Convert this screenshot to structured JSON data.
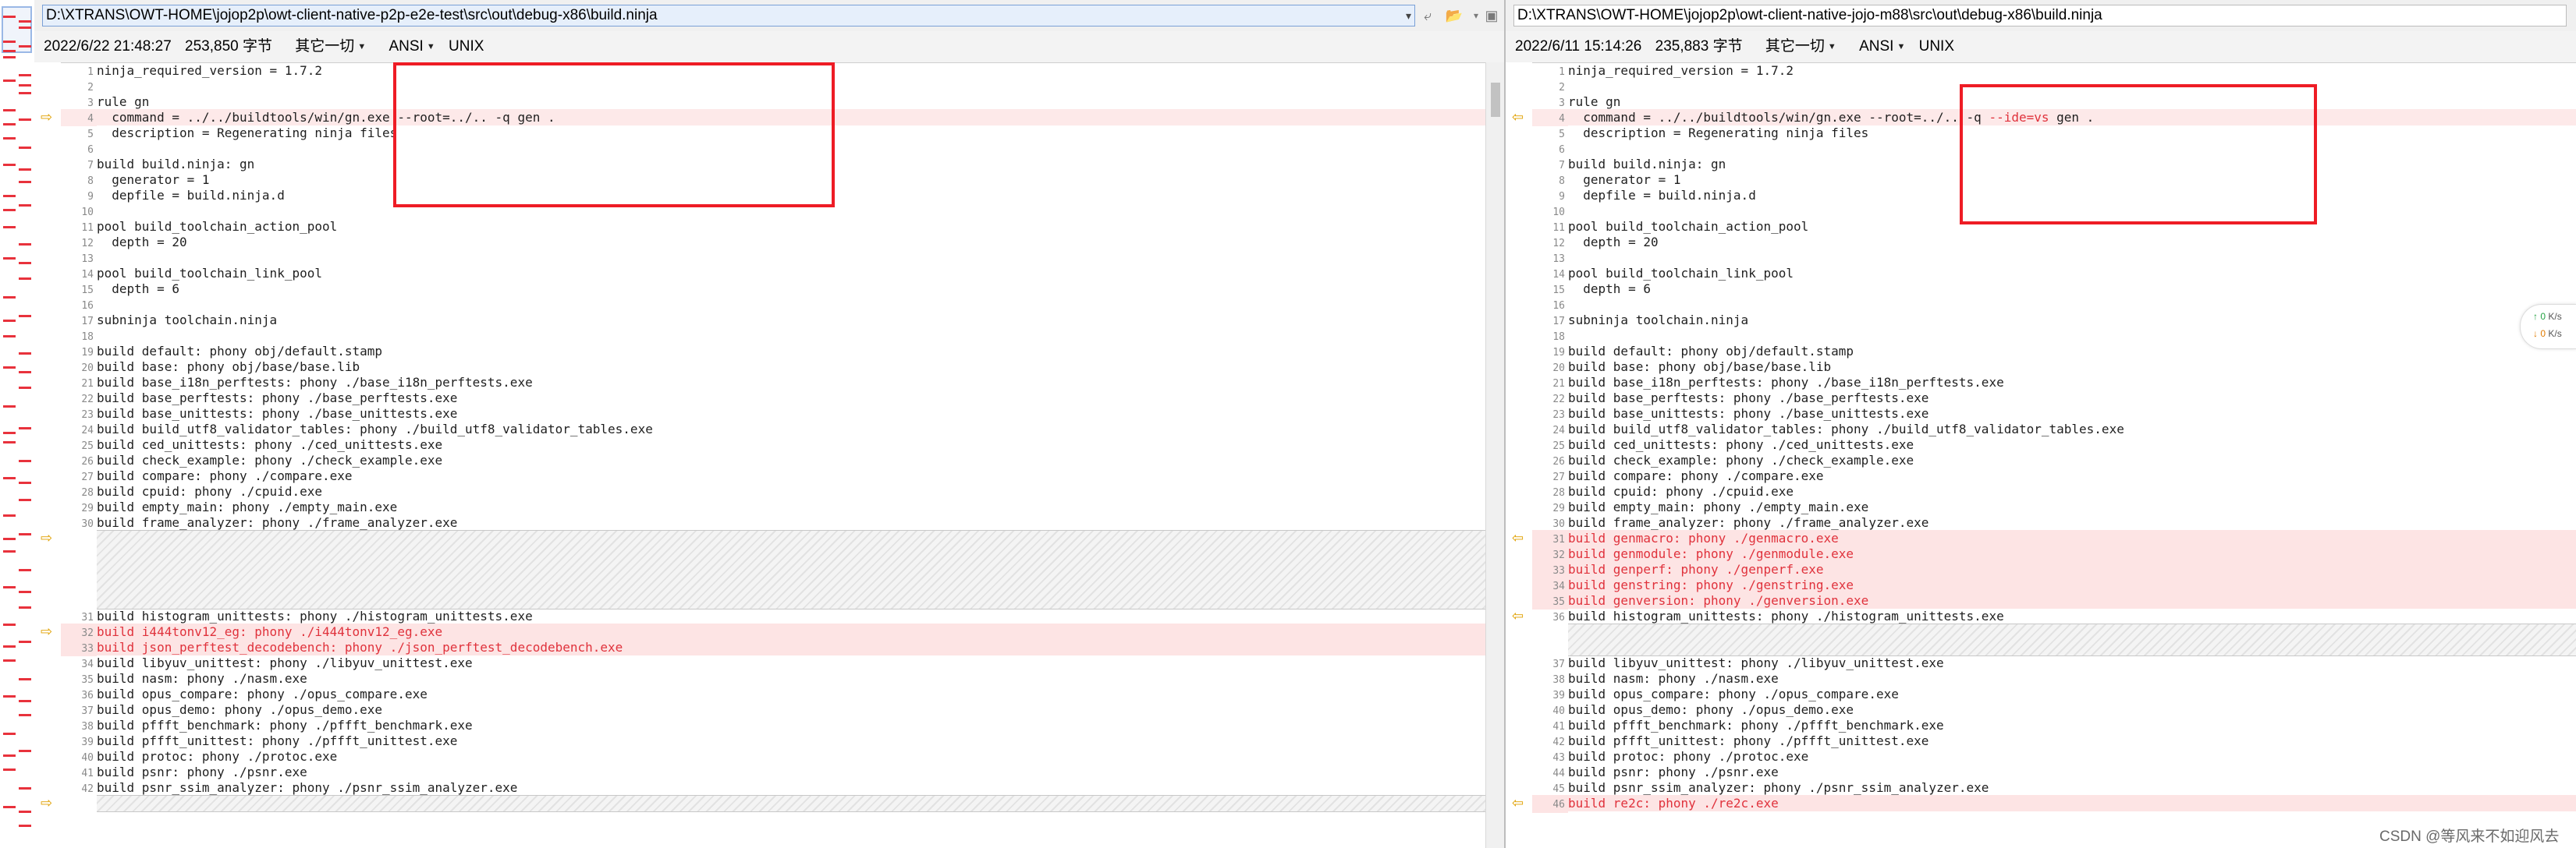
{
  "left": {
    "path": "D:\\XTRANS\\OWT-HOME\\jojop2p\\owt-client-native-p2p-e2e-test\\src\\out\\debug-x86\\build.ninja",
    "datetime": "2022/6/22 21:48:27",
    "size": "253,850 字节",
    "filter": "其它一切",
    "encoding": "ANSI",
    "eol": "UNIX",
    "lines": [
      {
        "n": "1",
        "t": "ninja_required_version = 1.7.2",
        "c": ""
      },
      {
        "n": "2",
        "t": "",
        "c": ""
      },
      {
        "n": "3",
        "t": "rule gn",
        "c": ""
      },
      {
        "n": "4",
        "t": "  command = ../../buildtools/win/gn.exe --root=../.. -q gen .",
        "c": "mod"
      },
      {
        "n": "5",
        "t": "  description = Regenerating ninja files",
        "c": ""
      },
      {
        "n": "6",
        "t": "",
        "c": ""
      },
      {
        "n": "7",
        "t": "build build.ninja: gn",
        "c": ""
      },
      {
        "n": "8",
        "t": "  generator = 1",
        "c": ""
      },
      {
        "n": "9",
        "t": "  depfile = build.ninja.d",
        "c": ""
      },
      {
        "n": "10",
        "t": "",
        "c": ""
      },
      {
        "n": "11",
        "t": "pool build_toolchain_action_pool",
        "c": ""
      },
      {
        "n": "12",
        "t": "  depth = 20",
        "c": ""
      },
      {
        "n": "13",
        "t": "",
        "c": ""
      },
      {
        "n": "14",
        "t": "pool build_toolchain_link_pool",
        "c": ""
      },
      {
        "n": "15",
        "t": "  depth = 6",
        "c": ""
      },
      {
        "n": "16",
        "t": "",
        "c": ""
      },
      {
        "n": "17",
        "t": "subninja toolchain.ninja",
        "c": ""
      },
      {
        "n": "18",
        "t": "",
        "c": ""
      },
      {
        "n": "19",
        "t": "build default: phony obj/default.stamp",
        "c": ""
      },
      {
        "n": "20",
        "t": "build base: phony obj/base/base.lib",
        "c": ""
      },
      {
        "n": "21",
        "t": "build base_i18n_perftests: phony ./base_i18n_perftests.exe",
        "c": ""
      },
      {
        "n": "22",
        "t": "build base_perftests: phony ./base_perftests.exe",
        "c": ""
      },
      {
        "n": "23",
        "t": "build base_unittests: phony ./base_unittests.exe",
        "c": ""
      },
      {
        "n": "24",
        "t": "build build_utf8_validator_tables: phony ./build_utf8_validator_tables.exe",
        "c": ""
      },
      {
        "n": "25",
        "t": "build ced_unittests: phony ./ced_unittests.exe",
        "c": ""
      },
      {
        "n": "26",
        "t": "build check_example: phony ./check_example.exe",
        "c": ""
      },
      {
        "n": "27",
        "t": "build compare: phony ./compare.exe",
        "c": ""
      },
      {
        "n": "28",
        "t": "build cpuid: phony ./cpuid.exe",
        "c": ""
      },
      {
        "n": "29",
        "t": "build empty_main: phony ./empty_main.exe",
        "c": ""
      },
      {
        "n": "30",
        "t": "build frame_analyzer: phony ./frame_analyzer.exe",
        "c": ""
      },
      {
        "n": "",
        "t": "",
        "c": "gap"
      },
      {
        "n": "",
        "t": "",
        "c": "gap"
      },
      {
        "n": "",
        "t": "",
        "c": "gap"
      },
      {
        "n": "",
        "t": "",
        "c": "gap"
      },
      {
        "n": "",
        "t": "",
        "c": "gap"
      },
      {
        "n": "31",
        "t": "build histogram_unittests: phony ./histogram_unittests.exe",
        "c": ""
      },
      {
        "n": "32",
        "t": "build i444tonv12_eg: phony ./i444tonv12_eg.exe",
        "c": "chg"
      },
      {
        "n": "33",
        "t": "build json_perftest_decodebench: phony ./json_perftest_decodebench.exe",
        "c": "chg"
      },
      {
        "n": "34",
        "t": "build libyuv_unittest: phony ./libyuv_unittest.exe",
        "c": ""
      },
      {
        "n": "35",
        "t": "build nasm: phony ./nasm.exe",
        "c": ""
      },
      {
        "n": "36",
        "t": "build opus_compare: phony ./opus_compare.exe",
        "c": ""
      },
      {
        "n": "37",
        "t": "build opus_demo: phony ./opus_demo.exe",
        "c": ""
      },
      {
        "n": "38",
        "t": "build pffft_benchmark: phony ./pffft_benchmark.exe",
        "c": ""
      },
      {
        "n": "39",
        "t": "build pffft_unittest: phony ./pffft_unittest.exe",
        "c": ""
      },
      {
        "n": "40",
        "t": "build protoc: phony ./protoc.exe",
        "c": ""
      },
      {
        "n": "41",
        "t": "build psnr: phony ./psnr.exe",
        "c": ""
      },
      {
        "n": "42",
        "t": "build psnr_ssim_analyzer: phony ./psnr_ssim_analyzer.exe",
        "c": ""
      },
      {
        "n": "43",
        "t": "",
        "c": "gap"
      }
    ]
  },
  "right": {
    "path": "D:\\XTRANS\\OWT-HOME\\jojop2p\\owt-client-native-jojo-m88\\src\\out\\debug-x86\\build.ninja",
    "datetime": "2022/6/11 15:14:26",
    "size": "235,883 字节",
    "filter": "其它一切",
    "encoding": "ANSI",
    "eol": "UNIX",
    "line4_a": "  command = ../../buildtools/win/gn.exe --root=../.. -q ",
    "line4_b": "--ide=vs",
    "line4_c": " gen .",
    "lines": [
      {
        "n": "1",
        "t": "ninja_required_version = 1.7.2",
        "c": ""
      },
      {
        "n": "2",
        "t": "",
        "c": ""
      },
      {
        "n": "3",
        "t": "rule gn",
        "c": ""
      },
      {
        "n": "4",
        "t": "",
        "c": "mod4"
      },
      {
        "n": "5",
        "t": "  description = Regenerating ninja files",
        "c": ""
      },
      {
        "n": "6",
        "t": "",
        "c": ""
      },
      {
        "n": "7",
        "t": "build build.ninja: gn",
        "c": ""
      },
      {
        "n": "8",
        "t": "  generator = 1",
        "c": ""
      },
      {
        "n": "9",
        "t": "  depfile = build.ninja.d",
        "c": ""
      },
      {
        "n": "10",
        "t": "",
        "c": ""
      },
      {
        "n": "11",
        "t": "pool build_toolchain_action_pool",
        "c": ""
      },
      {
        "n": "12",
        "t": "  depth = 20",
        "c": ""
      },
      {
        "n": "13",
        "t": "",
        "c": ""
      },
      {
        "n": "14",
        "t": "pool build_toolchain_link_pool",
        "c": ""
      },
      {
        "n": "15",
        "t": "  depth = 6",
        "c": ""
      },
      {
        "n": "16",
        "t": "",
        "c": ""
      },
      {
        "n": "17",
        "t": "subninja toolchain.ninja",
        "c": ""
      },
      {
        "n": "18",
        "t": "",
        "c": ""
      },
      {
        "n": "19",
        "t": "build default: phony obj/default.stamp",
        "c": ""
      },
      {
        "n": "20",
        "t": "build base: phony obj/base/base.lib",
        "c": ""
      },
      {
        "n": "21",
        "t": "build base_i18n_perftests: phony ./base_i18n_perftests.exe",
        "c": ""
      },
      {
        "n": "22",
        "t": "build base_perftests: phony ./base_perftests.exe",
        "c": ""
      },
      {
        "n": "23",
        "t": "build base_unittests: phony ./base_unittests.exe",
        "c": ""
      },
      {
        "n": "24",
        "t": "build build_utf8_validator_tables: phony ./build_utf8_validator_tables.exe",
        "c": ""
      },
      {
        "n": "25",
        "t": "build ced_unittests: phony ./ced_unittests.exe",
        "c": ""
      },
      {
        "n": "26",
        "t": "build check_example: phony ./check_example.exe",
        "c": ""
      },
      {
        "n": "27",
        "t": "build compare: phony ./compare.exe",
        "c": ""
      },
      {
        "n": "28",
        "t": "build cpuid: phony ./cpuid.exe",
        "c": ""
      },
      {
        "n": "29",
        "t": "build empty_main: phony ./empty_main.exe",
        "c": ""
      },
      {
        "n": "30",
        "t": "build frame_analyzer: phony ./frame_analyzer.exe",
        "c": ""
      },
      {
        "n": "31",
        "t": "build genmacro: phony ./genmacro.exe",
        "c": "chg"
      },
      {
        "n": "32",
        "t": "build genmodule: phony ./genmodule.exe",
        "c": "chg"
      },
      {
        "n": "33",
        "t": "build genperf: phony ./genperf.exe",
        "c": "chg"
      },
      {
        "n": "34",
        "t": "build genstring: phony ./genstring.exe",
        "c": "chg"
      },
      {
        "n": "35",
        "t": "build genversion: phony ./genversion.exe",
        "c": "chg"
      },
      {
        "n": "36",
        "t": "build histogram_unittests: phony ./histogram_unittests.exe",
        "c": ""
      },
      {
        "n": "",
        "t": "",
        "c": "gap"
      },
      {
        "n": "",
        "t": "",
        "c": "gap"
      },
      {
        "n": "37",
        "t": "build libyuv_unittest: phony ./libyuv_unittest.exe",
        "c": ""
      },
      {
        "n": "38",
        "t": "build nasm: phony ./nasm.exe",
        "c": ""
      },
      {
        "n": "39",
        "t": "build opus_compare: phony ./opus_compare.exe",
        "c": ""
      },
      {
        "n": "40",
        "t": "build opus_demo: phony ./opus_demo.exe",
        "c": ""
      },
      {
        "n": "41",
        "t": "build pffft_benchmark: phony ./pffft_benchmark.exe",
        "c": ""
      },
      {
        "n": "42",
        "t": "build pffft_unittest: phony ./pffft_unittest.exe",
        "c": ""
      },
      {
        "n": "43",
        "t": "build protoc: phony ./protoc.exe",
        "c": ""
      },
      {
        "n": "44",
        "t": "build psnr: phony ./psnr.exe",
        "c": ""
      },
      {
        "n": "45",
        "t": "build psnr_ssim_analyzer: phony ./psnr_ssim_analyzer.exe",
        "c": ""
      },
      {
        "n": "46",
        "t": "build re2c: phony ./re2c.exe",
        "c": "chg"
      }
    ]
  },
  "net_widget": {
    "up": "0",
    "down": "0",
    "unit": "K/s",
    "up_color": "#25a244",
    "down_color": "#e07b00"
  },
  "watermark": "CSDN @等风来不如迎风去",
  "colors": {
    "diff_red": "#e0323c",
    "diff_bg": "#fde4e4",
    "annotation": "#ee1c25",
    "arrow": "#e0a000"
  }
}
